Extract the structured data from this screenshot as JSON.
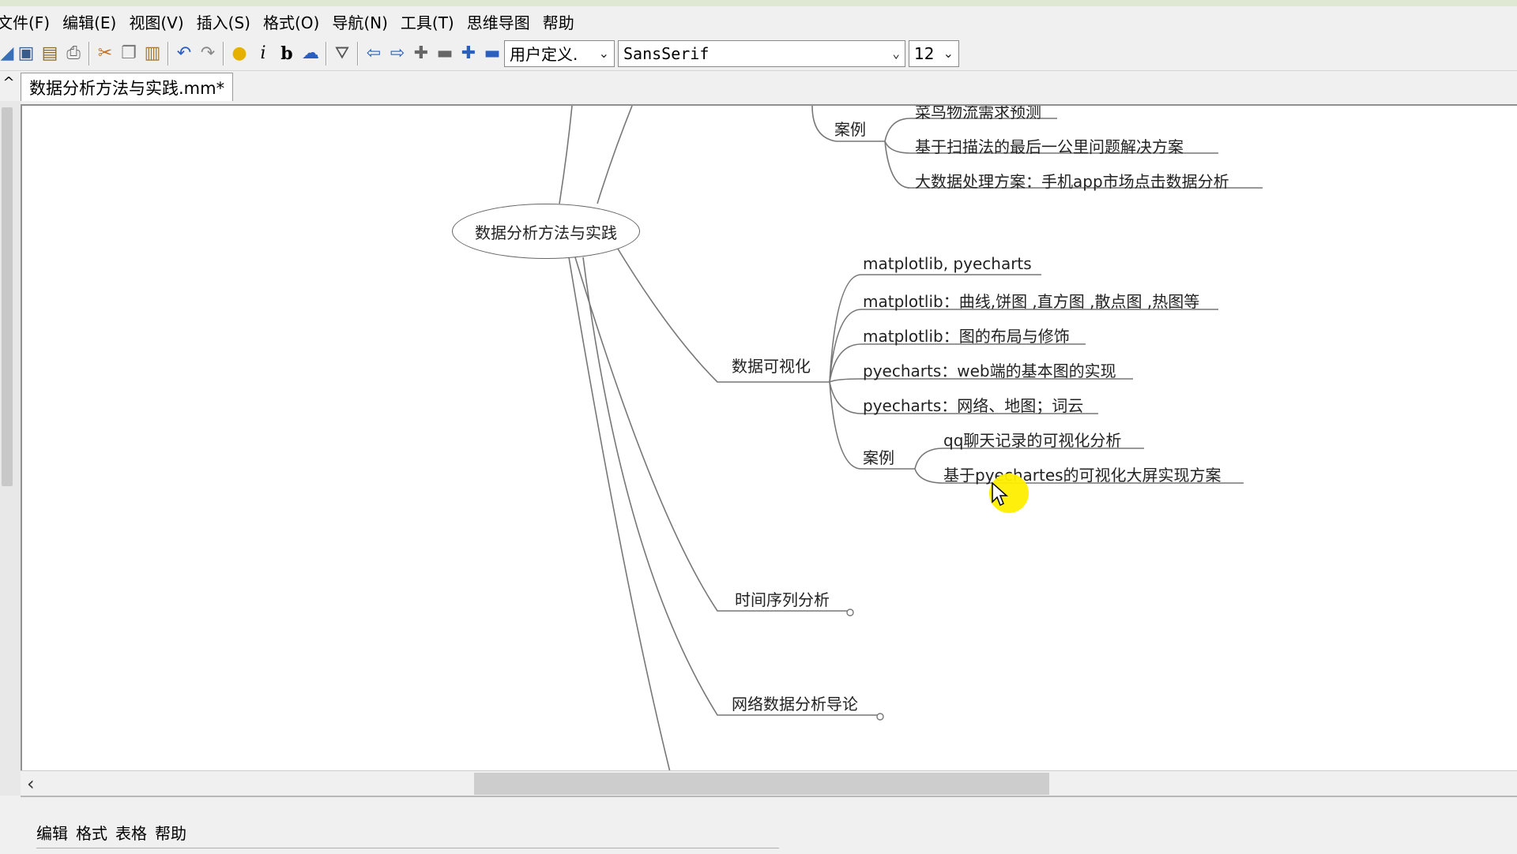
{
  "menubar": {
    "items": [
      "文件(F)",
      "编辑(E)",
      "视图(V)",
      "插入(S)",
      "格式(O)",
      "导航(N)",
      "工具(T)",
      "思维导图",
      "帮助"
    ]
  },
  "toolbar": {
    "icons": [
      "open-icon",
      "save-icon",
      "save-as-icon",
      "print-icon",
      "cut-icon",
      "copy-icon",
      "paste-icon",
      "undo-icon",
      "redo-icon",
      "idea-icon",
      "italic-icon",
      "bold-icon",
      "cloud-icon",
      "filter-icon",
      "back-icon",
      "forward-icon",
      "add-node-icon",
      "remove-node-icon",
      "add-child-icon",
      "remove-child-icon"
    ],
    "style_combo": "用户定义.",
    "font_combo": "SansSerif",
    "size_combo": "12"
  },
  "tab": {
    "title": "数据分析方法与实践.mm*"
  },
  "mindmap": {
    "root": "数据分析方法与实践",
    "case_top": {
      "label": "案例",
      "items": [
        "菜鸟物流需求预测",
        "基于扫描法的最后一公里问题解决方案",
        "大数据处理方案：手机app市场点击数据分析"
      ]
    },
    "viz": {
      "label": "数据可视化",
      "items": [
        "matplotlib, pyecharts",
        "matplotlib：曲线,饼图 ,直方图 ,散点图 ,热图等",
        "matplotlib：图的布局与修饰",
        "pyecharts：web端的基本图的实现",
        "pyecharts：网络、地图；词云"
      ],
      "case": {
        "label": "案例",
        "items": [
          "qq聊天记录的可视化分析",
          "基于pyechartes的可视化大屏实现方案"
        ]
      }
    },
    "timeseries": "时间序列分析",
    "network": "网络数据分析导论"
  },
  "notes": {
    "menu": [
      "编辑",
      "格式",
      "表格",
      "帮助"
    ]
  },
  "colors": {
    "cursor_highlight": "#ffee00",
    "edge": "#777777"
  }
}
